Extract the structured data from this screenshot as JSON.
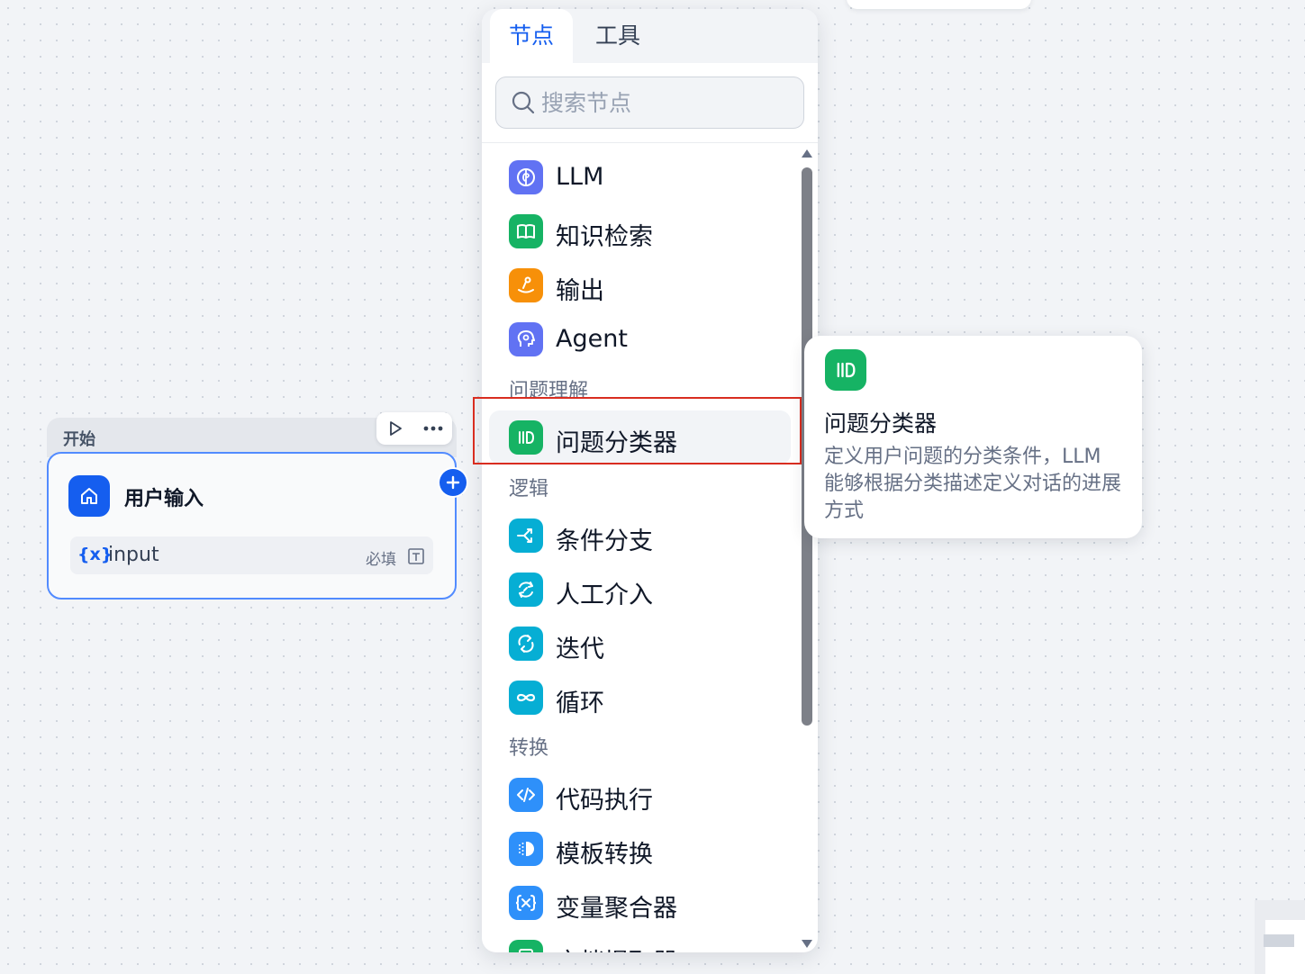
{
  "canvas": {
    "start_node": {
      "header_label": "开始",
      "title": "用户输入",
      "variable": {
        "icon_text": "{x}",
        "name": "input",
        "required_label": "必填"
      }
    }
  },
  "panel": {
    "tabs": [
      {
        "label": "节点",
        "active": true
      },
      {
        "label": "工具",
        "active": false
      }
    ],
    "search": {
      "placeholder": "搜索节点",
      "value": ""
    },
    "items": {
      "llm": "LLM",
      "knowledge": "知识检索",
      "output": "输出",
      "agent": "Agent",
      "classifier": "问题分类器",
      "if_else": "条件分支",
      "human": "人工介入",
      "iteration": "迭代",
      "loop": "循环",
      "code": "代码执行",
      "template": "模板转换",
      "var_agg": "变量聚合器",
      "doc_extract": "文档提取器"
    },
    "groups": {
      "question": "问题理解",
      "logic": "逻辑",
      "transform": "转换"
    }
  },
  "tooltip": {
    "title": "问题分类器",
    "description": "定义用户问题的分类条件，LLM 能够根据分类描述定义对话的进展方式"
  },
  "colors": {
    "primary": "#155eef",
    "llm": "#6172f3",
    "green": "#16b364",
    "orange": "#f79009",
    "cyan": "#06aed4",
    "blue": "#2e90fa",
    "highlight": "#d92d20"
  }
}
